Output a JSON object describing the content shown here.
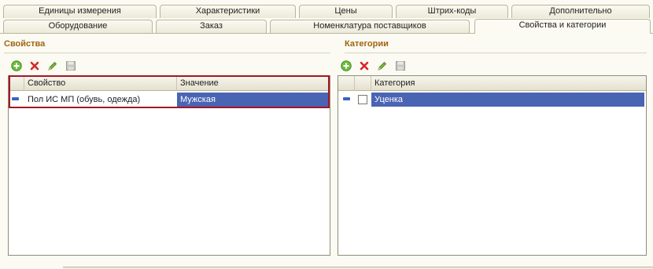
{
  "tabs_row1": [
    {
      "label": "Единицы измерения"
    },
    {
      "label": "Характеристики"
    },
    {
      "label": "Цены"
    },
    {
      "label": "Штрих-коды"
    },
    {
      "label": "Дополнительно"
    }
  ],
  "tabs_row2": [
    {
      "label": "Оборудование"
    },
    {
      "label": "Заказ"
    },
    {
      "label": "Номенклатура поставщиков"
    },
    {
      "label": "Свойства и категории",
      "active": true
    }
  ],
  "properties": {
    "title": "Свойства",
    "columns": [
      "Свойство",
      "Значение"
    ],
    "rows": [
      {
        "property": "Пол ИС МП (обувь, одежда)",
        "value": "Мужская"
      }
    ]
  },
  "categories": {
    "title": "Категории",
    "columns": [
      "Категория"
    ],
    "rows": [
      {
        "category": "Уценка",
        "checked": false
      }
    ]
  },
  "toolbar_icons": [
    "add-icon",
    "delete-icon",
    "edit-icon",
    "save-icon"
  ],
  "colors": {
    "accent_title": "#a06410",
    "selection": "#4a64b4",
    "focus_frame": "#a31726",
    "background": "#fbfaf3"
  }
}
